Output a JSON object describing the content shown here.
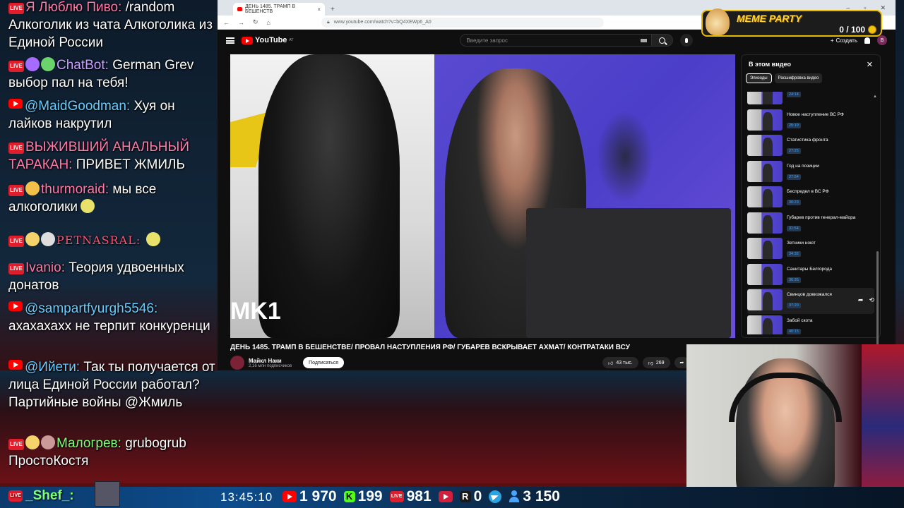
{
  "chat": {
    "messages": [
      {
        "name": "Я Люблю Пиво:",
        "text": "/random Алкоголик из чата Алкоголика из Единой России"
      },
      {
        "name": "ChatBot:",
        "text": "German Grev выбор пал на тебя!"
      },
      {
        "name": "@MaidGoodman:",
        "text": "Хуя он лайков накрутил"
      },
      {
        "name": "ВЫЖИВШИЙ АНАЛЬНЫЙ ТАРАКАН:",
        "text": "ПРИВЕТ ЖМИЛЬ"
      },
      {
        "name": "thurmoraid:",
        "text": "мы все алкоголики"
      },
      {
        "name": "PETNASRAL:",
        "text": ""
      },
      {
        "name": "Ivanio:",
        "text": "Теория удвоенных донатов"
      },
      {
        "name": "@sampartfyurgh5546:",
        "text": "ахахахахх не терпит конкуренци"
      },
      {
        "name": "@Ийети:",
        "text": "Так ты получается от лица Единой России работал? Партийные войны @Жмиль"
      },
      {
        "name": "Малогрев:",
        "text": "grubogrub ПростоКостя"
      }
    ]
  },
  "browser": {
    "tab_title": "ДЕНЬ 1485. ТРАМП В БЕШЕНСТВ",
    "url": "www.youtube.com/watch?v=bQ4XEWp6_A0",
    "new_tab": "+",
    "close": "×"
  },
  "youtube": {
    "logo": "YouTube",
    "region": "AT",
    "search_placeholder": "Введите запрос",
    "create_label": "Создать",
    "avatar_letter": "В",
    "video_overlay": "MK1",
    "video_title": "ДЕНЬ 1485. ТРАМП В БЕШЕНСТВЕ/ ПРОВАЛ НАСТУПЛЕНИЯ РФ/ ГУБАРЕВ ВСКРЫВАЕТ АХМАТ/ КОНТРАТАКИ ВСУ",
    "channel_name": "Майкл Наки",
    "subscribers": "2,16 млн подписчиков",
    "subscribe_label": "Подписаться",
    "likes": "43 тыс.",
    "dislikes": "269",
    "panel": {
      "title": "В этом видео",
      "chip_episodes": "Эпизоды",
      "chip_transcript": "Расшифровка видео",
      "episodes": [
        {
          "title": "",
          "time": "24:14"
        },
        {
          "title": "Новое наступление ВС РФ",
          "time": "25:19"
        },
        {
          "title": "Статистика фронта",
          "time": "27:25"
        },
        {
          "title": "Год на позиции",
          "time": "27:54"
        },
        {
          "title": "Беспредел в ВС РФ",
          "time": "30:23"
        },
        {
          "title": "Губарев против генерал-майора",
          "time": "31:54"
        },
        {
          "title": "Зетники ноют",
          "time": "34:32"
        },
        {
          "title": "Санитары Белгорода",
          "time": "36:35"
        },
        {
          "title": "Свинцов довизжался",
          "time": "37:20"
        },
        {
          "title": "Забой скота",
          "time": "40:15"
        }
      ]
    }
  },
  "meme_widget": {
    "title": "MEME PARTY",
    "count": "0 / 100"
  },
  "bottom_bar": {
    "user": "_Shef_:",
    "time": "13:45:10",
    "youtube_viewers": "1 970",
    "kick_viewers": "199",
    "live_viewers": "981",
    "rutube_viewers": "",
    "rumble_viewers": "0",
    "total_viewers": "3 150"
  }
}
